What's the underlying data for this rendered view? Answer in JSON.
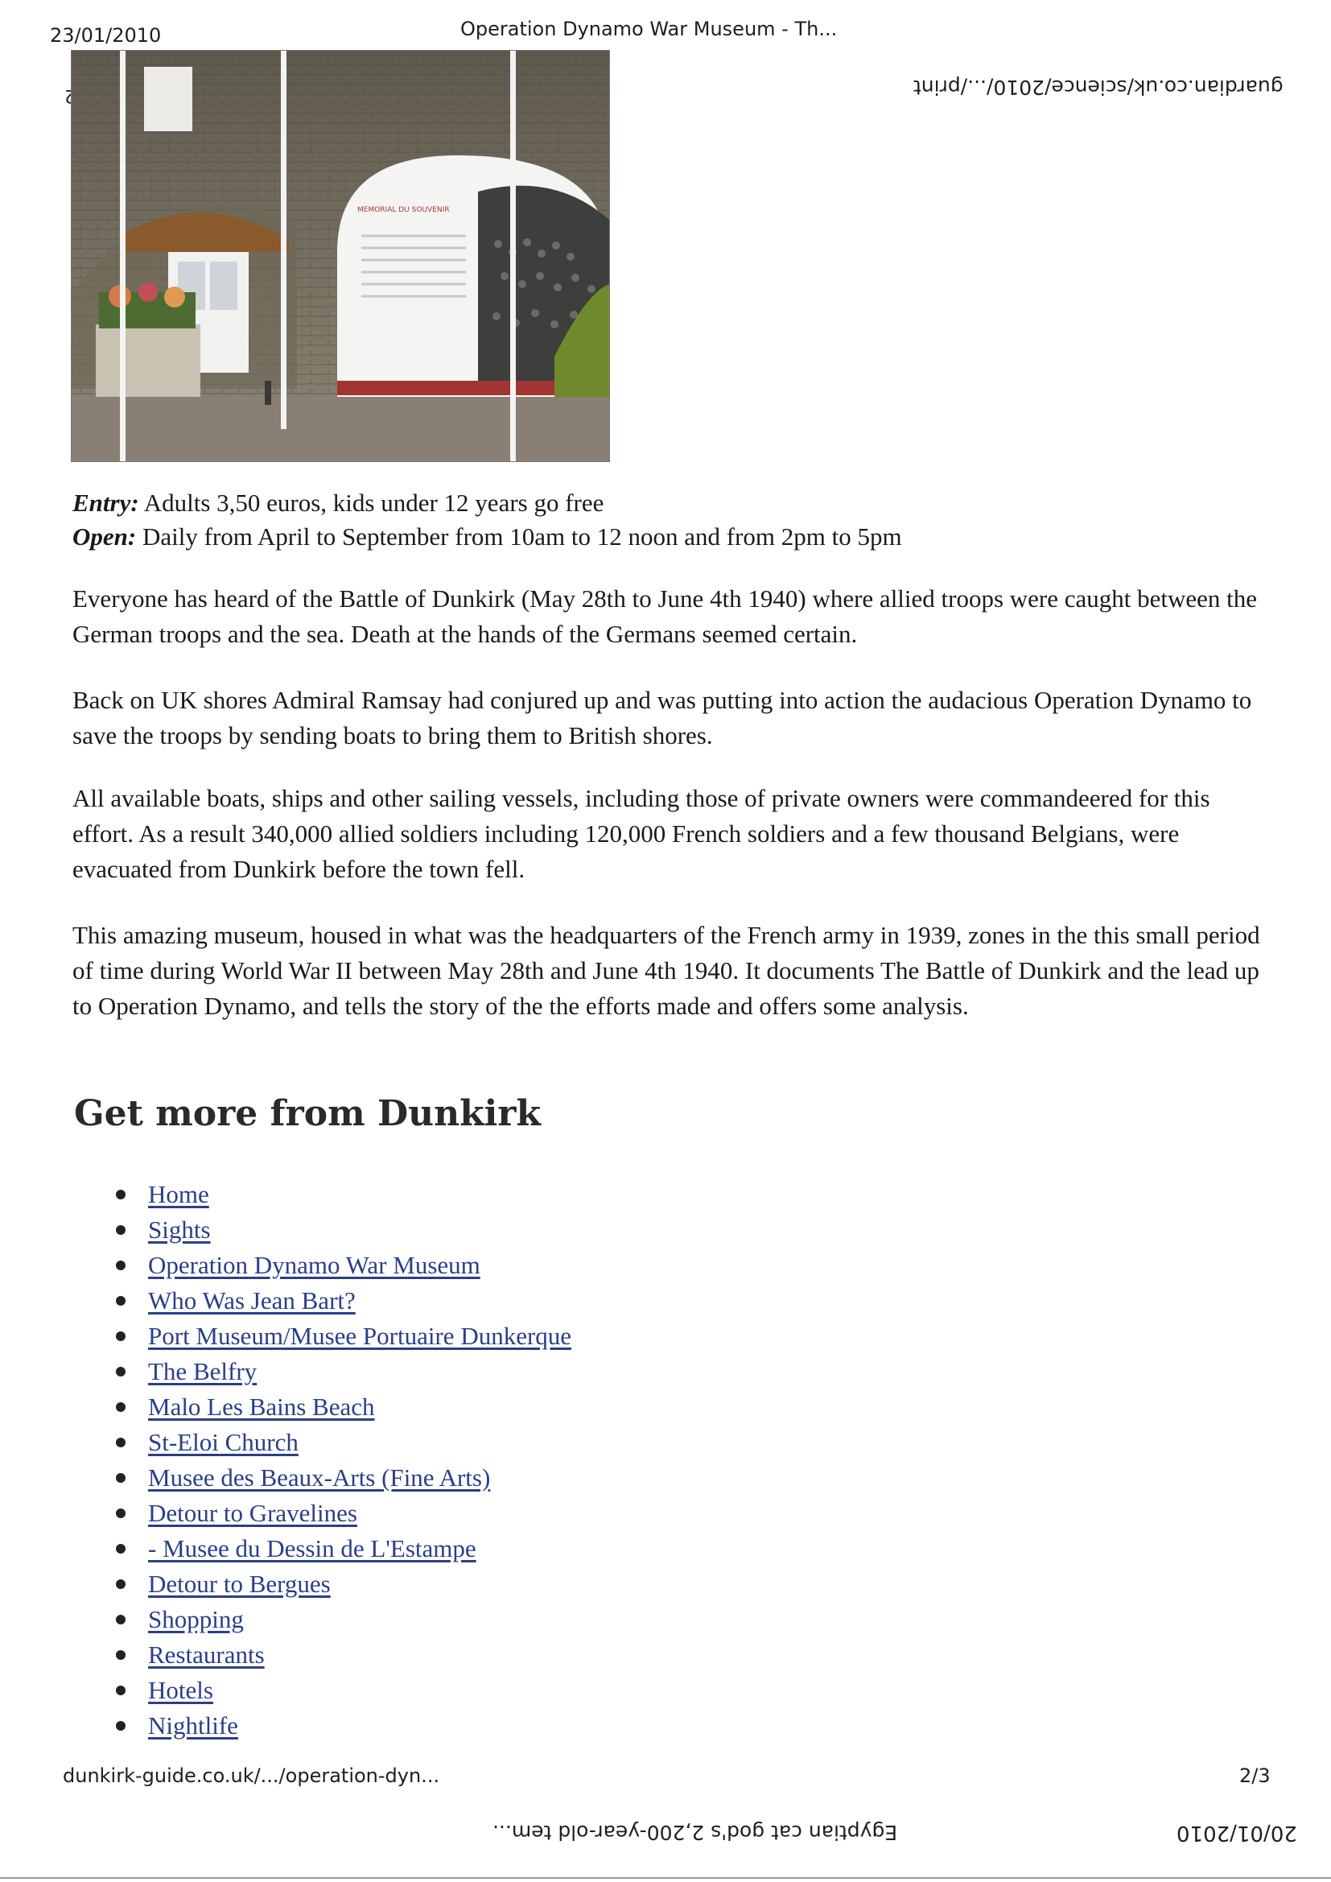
{
  "header": {
    "date": "23/01/2010",
    "title": "Operation Dynamo War Museum - Th...",
    "flipped_url": "guardian.co.uk/science/2010/.../print",
    "flipped_page": "2/2"
  },
  "photo": {
    "sign_text": "MEMORIAL DU SOUVENIR"
  },
  "info": {
    "entry_label": "Entry:",
    "entry_text": " Adults 3,50 euros, kids under 12 years go free",
    "open_label": "Open:",
    "open_text": " Daily from April to September from 10am to 12 noon and from 2pm to 5pm"
  },
  "paragraphs": [
    "Everyone has heard of the Battle of Dunkirk (May 28th to June 4th 1940) where allied troops were caught between the German troops and the sea. Death at the hands of the Germans seemed certain.",
    "Back on UK shores Admiral Ramsay had conjured up and was putting into action the audacious Operation Dynamo to save the troops by sending boats to bring them to British shores.",
    "All available boats, ships and other sailing vessels, including those of private owners were commandeered for this effort. As a result 340,000 allied soldiers including 120,000 French soldiers and a few thousand Belgians, were evacuated from Dunkirk before the town fell.",
    "This amazing museum, housed in what was the headquarters of the French army in 1939, zones in the this small period of time during World War II between May 28th and June 4th 1940. It documents The Battle of Dunkirk and the lead up to Operation Dynamo, and tells the story of the the efforts made and offers some analysis."
  ],
  "more": {
    "title": "Get more from Dunkirk",
    "links": [
      "Home",
      "Sights",
      "Operation Dynamo War Museum",
      "Who Was Jean Bart?",
      "Port Museum/Musee Portuaire Dunkerque",
      "The Belfry",
      "Malo Les Bains Beach",
      "St-Eloi Church",
      "Musee des Beaux-Arts (Fine Arts)",
      "Detour to Gravelines",
      "- Musee du Dessin de L'Estampe",
      "Detour to Bergues",
      "Shopping",
      "Restaurants",
      "Hotels",
      "Nightlife"
    ]
  },
  "footer": {
    "url": "dunkirk-guide.co.uk/.../operation-dyn...",
    "page": "2/3",
    "flipped_title": "Egyptian cat god's 2,200-year-old tem...",
    "flipped_date": "20/01/2010"
  }
}
